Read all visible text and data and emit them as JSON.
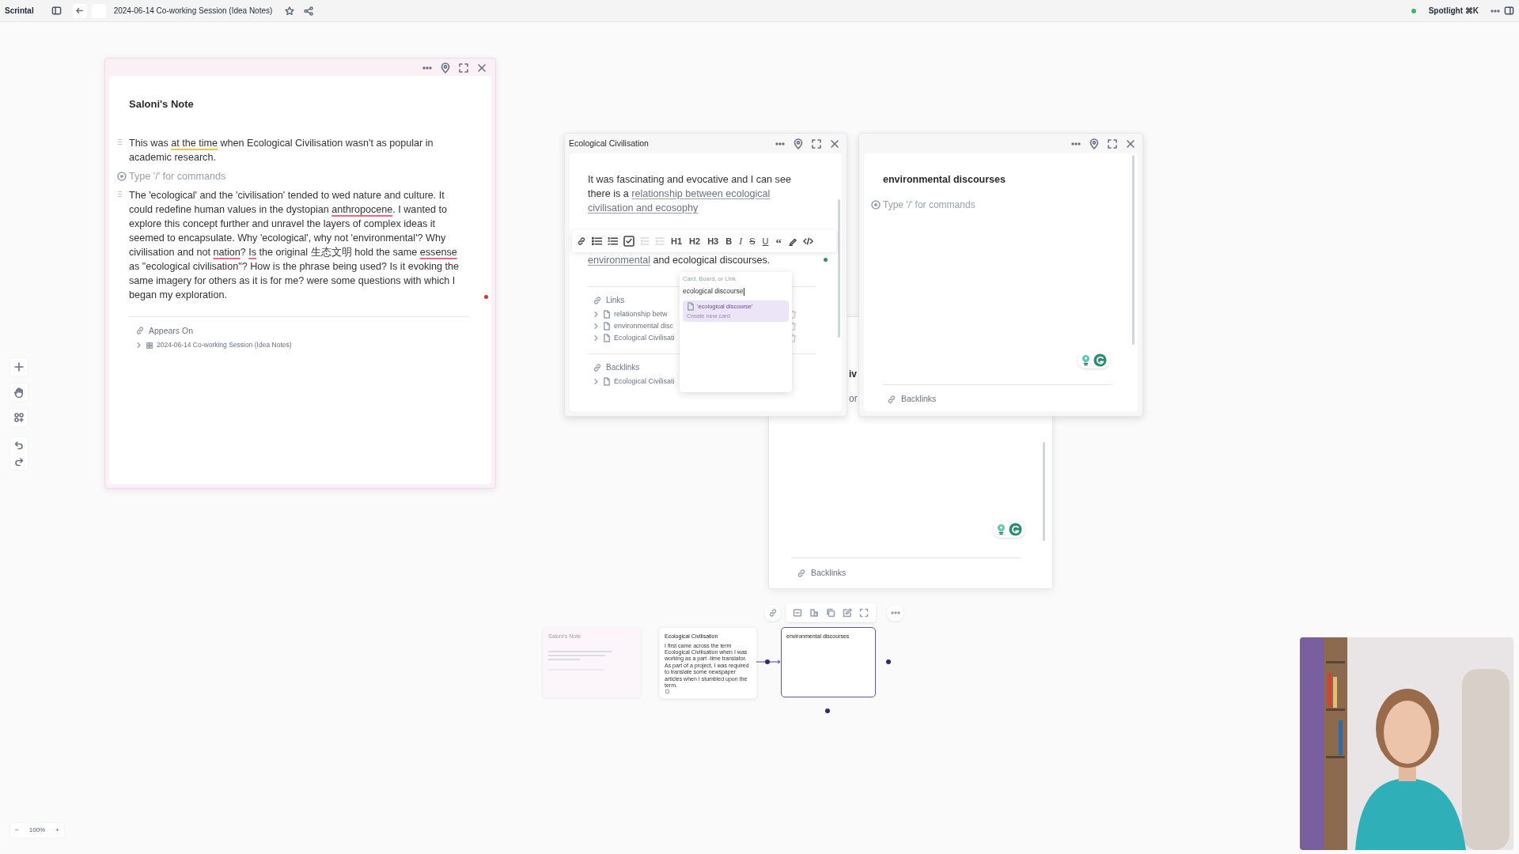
{
  "top_bar": {
    "app_name": "Scrintal",
    "board_title": "2024-06-14 Co-working Session (Idea Notes)",
    "starred": false,
    "spotlight": "Spotlight ⌘K"
  },
  "saloni_card": {
    "title": "Saloni's Note",
    "blocks": [
      {
        "kind": "text",
        "segments": [
          {
            "text": "This was "
          },
          {
            "text": "at the time",
            "kind": "grammar"
          },
          {
            "text": " when Ecological Civilisation wasn't as popular in academic research."
          }
        ]
      },
      {
        "kind": "prompt",
        "text": "Type '/' for commands"
      },
      {
        "kind": "text",
        "segments": [
          {
            "text": "The 'ecological' and the 'civilisation' tended to wed nature and culture. It could redefine human values in the dystopian "
          },
          {
            "text": "anthropocene",
            "kind": "spelling"
          },
          {
            "text": ". I wanted to explore this concept further and unravel the layers of complex ideas it seemed to encapsulate. Why 'ecological', why not 'environmental'? Why civilisation and not "
          },
          {
            "text": "nation",
            "kind": "spelling"
          },
          {
            "text": "? "
          },
          {
            "text": "Is",
            "kind": "spelling"
          },
          {
            "text": " the original 生态文明 hold the same "
          },
          {
            "text": "essense",
            "kind": "spelling"
          },
          {
            "text": " as \"ecological civilisation\"? How is the phrase being used? Is it evoking the same imagery for others as it is for me? were some questions with which I began my exploration."
          }
        ]
      }
    ],
    "appears_on": {
      "heading": "Appears On",
      "items": [
        {
          "label": "2024-06-14 Co-working Session (Idea Notes)",
          "expanded": false
        }
      ]
    }
  },
  "ecological_card": {
    "title": "Ecological Civilisation",
    "blocks": [
      {
        "kind": "text",
        "segments": [
          {
            "text": "It was fascinating and evocative and I can see there is a "
          },
          {
            "text": "relationship between ecological civilisation and ecosophy",
            "kind": "link"
          }
        ]
      },
      {
        "kind": "text",
        "segments": [
          {
            "text": "environmental",
            "kind": "link"
          },
          {
            "text": " and ecological discourses."
          }
        ]
      }
    ],
    "format_toolbar": [
      {
        "kind": "link",
        "disabled": false
      },
      {
        "kind": "bullets",
        "disabled": false
      },
      {
        "kind": "numbered",
        "disabled": false
      },
      {
        "kind": "checkbox",
        "disabled": false
      },
      {
        "kind": "outdent",
        "disabled": true
      },
      {
        "kind": "indent",
        "disabled": true
      },
      {
        "kind": "label",
        "label": "H1",
        "disabled": false
      },
      {
        "kind": "label",
        "label": "H2",
        "disabled": false
      },
      {
        "kind": "label",
        "label": "H3",
        "disabled": false
      },
      {
        "kind": "bold",
        "label": "B",
        "disabled": false
      },
      {
        "kind": "italic",
        "label": "I",
        "disabled": false
      },
      {
        "kind": "strike",
        "label": "S",
        "disabled": false
      },
      {
        "kind": "underline",
        "label": "U",
        "disabled": false
      },
      {
        "kind": "quote",
        "label": "“",
        "disabled": false
      },
      {
        "kind": "highlight",
        "disabled": false
      },
      {
        "kind": "code",
        "disabled": false
      }
    ],
    "links": {
      "heading": "Links",
      "items": [
        {
          "label": "relationship betw",
          "expanded": false
        },
        {
          "label": "environmental disc",
          "expanded": false
        },
        {
          "label": "Ecological Civilisati",
          "expanded": false
        }
      ]
    },
    "backlinks": {
      "heading": "Backlinks",
      "items": [
        {
          "label": "Ecological Civilisati",
          "expanded": false
        }
      ]
    },
    "link_popup": {
      "label": "Card, Board, or Link",
      "query": "ecological discourse",
      "options": [
        {
          "title": "'ecological discourse'",
          "subtitle": "Create new card",
          "selected": true
        }
      ]
    }
  },
  "environmental_card": {
    "title": "environmental discourses",
    "prompt": "Type '/' for commands",
    "backlinks": "Backlinks"
  },
  "hidden_card": {
    "peek_texts": [
      "iv",
      "or"
    ],
    "backlinks": "Backlinks"
  },
  "minimap": {
    "cards": [
      {
        "title": "Saloni's Note",
        "faded": true,
        "selected": false
      },
      {
        "title": "Ecological Civilisation",
        "body": "I first came across the term Ecological Civilisation when I was working as a part -time translator. As part of a project, I was required to translate some newspaper articles when I stumbled upon the term.",
        "faded": false,
        "selected": false
      },
      {
        "title": "environmental discourses",
        "faded": false,
        "selected": true
      }
    ]
  },
  "zoom": {
    "minus": "−",
    "value": "100%",
    "plus": "+"
  }
}
